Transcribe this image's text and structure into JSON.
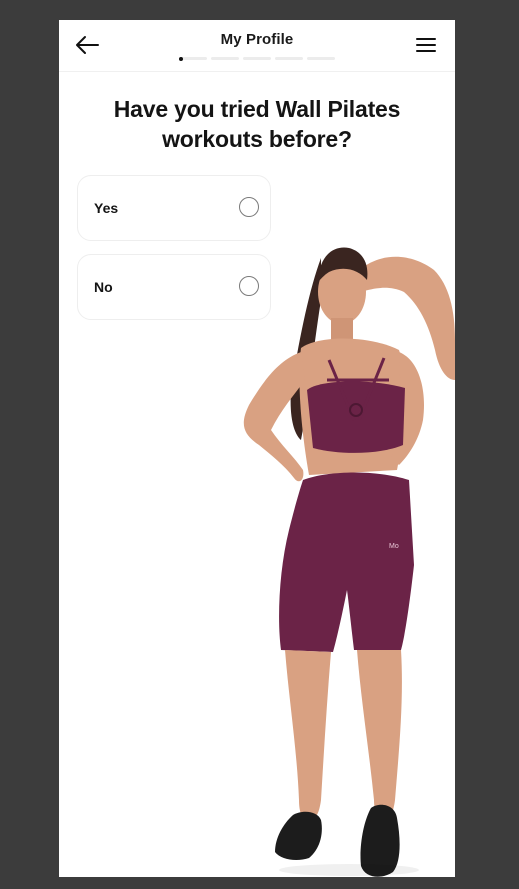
{
  "header": {
    "title": "My Profile",
    "back_icon": "arrow-left-icon",
    "menu_icon": "hamburger-menu-icon",
    "progress": {
      "total_steps": 5,
      "current_step": 1
    }
  },
  "question": {
    "text": "Have you tried Wall Pilates workouts before?"
  },
  "options": [
    {
      "label": "Yes",
      "selected": false
    },
    {
      "label": "No",
      "selected": false
    }
  ],
  "colors": {
    "outfit": "#6b2347",
    "skin": "#d9a182",
    "hair": "#3a2520",
    "shoes": "#1c1c1c"
  }
}
